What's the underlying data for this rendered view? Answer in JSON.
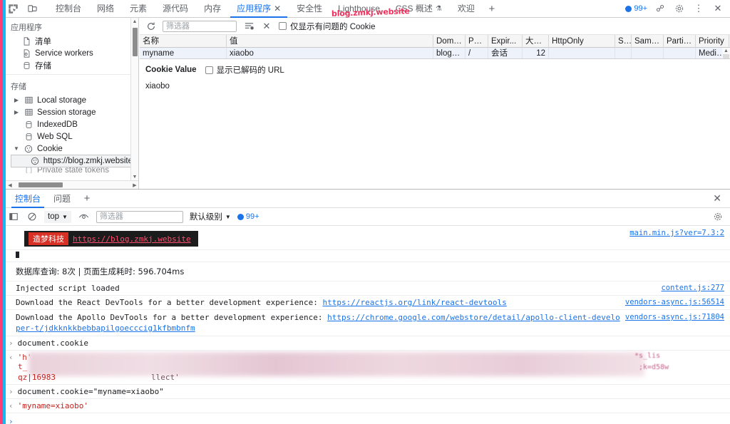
{
  "watermark": {
    "text": "blog.zmkj.website",
    "color": "#ef2f5c"
  },
  "topbar": {
    "icons": [
      {
        "name": "inspect-element-icon",
        "glyph": "inspect"
      },
      {
        "name": "device-toolbar-icon",
        "glyph": "device"
      }
    ],
    "tabs": [
      {
        "label": "控制台",
        "active": false,
        "closable": false
      },
      {
        "label": "网络",
        "active": false,
        "closable": false
      },
      {
        "label": "元素",
        "active": false,
        "closable": false
      },
      {
        "label": "源代码",
        "active": false,
        "closable": false
      },
      {
        "label": "内存",
        "active": false,
        "closable": false
      },
      {
        "label": "应用程序",
        "active": true,
        "closable": true
      },
      {
        "label": "安全性",
        "active": false,
        "closable": false
      },
      {
        "label": "Lighthouse",
        "active": false,
        "closable": false
      },
      {
        "label": "CSS 概述",
        "active": false,
        "closable": false
      },
      {
        "label": "欢迎",
        "active": false,
        "closable": false
      }
    ],
    "add_tab_label": "+",
    "error_badge": "99+",
    "right_icons": [
      {
        "name": "settings-devtools-icon"
      },
      {
        "name": "gear-icon"
      },
      {
        "name": "more-options-icon"
      },
      {
        "name": "close-devtools-icon"
      }
    ]
  },
  "sidebar": {
    "section_application": {
      "title": "应用程序",
      "items": [
        {
          "label": "清单",
          "icon": "manifest-icon"
        },
        {
          "label": "Service workers",
          "icon": "service-worker-icon"
        },
        {
          "label": "存储",
          "icon": "storage-icon"
        }
      ]
    },
    "section_storage": {
      "title": "存储",
      "items": [
        {
          "label": "Local storage",
          "icon": "table-icon",
          "twisty": "▶"
        },
        {
          "label": "Session storage",
          "icon": "table-icon",
          "twisty": "▶"
        },
        {
          "label": "IndexedDB",
          "icon": "database-icon",
          "twisty": ""
        },
        {
          "label": "Web SQL",
          "icon": "database-icon",
          "twisty": ""
        },
        {
          "label": "Cookie",
          "icon": "cookie-icon",
          "twisty": "▼"
        }
      ],
      "cookie_children": [
        {
          "label": "https://blog.zmkj.website",
          "icon": "cookie-icon",
          "selected": true
        }
      ]
    }
  },
  "cookie_toolbar": {
    "refresh_label": "refresh-icon",
    "filter_placeholder": "筛选器",
    "clear_filters_label": "clear-filter-icon",
    "clear_all_label": "clear-all-icon",
    "checkbox_label": "仅显示有问题的 Cookie",
    "checkbox_checked": false
  },
  "cookie_table": {
    "columns": [
      "名称",
      "值",
      "Domain",
      "Path",
      "Expir...",
      "大小",
      "HttpOnly",
      "S...",
      "SameS...",
      "Partiti...",
      "Priority"
    ],
    "sorted_column": "大小",
    "sort_arrow": "▲",
    "rows": [
      {
        "name": "myname",
        "value": "xiaobo",
        "domain": "blog.z...",
        "path": "/",
        "expires": "会话",
        "size": "12",
        "httponly": "",
        "secure": "",
        "samesite": "",
        "partition": "",
        "priority": "Medium"
      }
    ]
  },
  "cookie_preview": {
    "title": "Cookie Value",
    "decode_checkbox_label": "显示已解码的 URL",
    "decode_checked": false,
    "value": "xiaobo"
  },
  "drawer": {
    "tabs": [
      {
        "label": "控制台",
        "active": true
      },
      {
        "label": "问题",
        "active": false
      }
    ],
    "add_label": "+",
    "close_label": "✕"
  },
  "console_toolbar": {
    "sidebar_toggle": "console-sidebar-icon",
    "clear_label": "clear-console-icon",
    "context": "top",
    "context_caret": "▼",
    "eye_label": "live-expression-icon",
    "filter_placeholder": "筛选器",
    "level": "默认级别",
    "level_caret": "▼",
    "error_badge": "99+",
    "settings_label": "gear-icon"
  },
  "console_messages": [
    {
      "type": "banner",
      "badge": "造梦科技",
      "link": "https://blog.zmkj.website",
      "source": "main.min.js?ver=7.3:2"
    },
    {
      "type": "stats",
      "text": "数据库查询: 8次 | 页面生成耗时: 596.704ms",
      "source": ""
    },
    {
      "type": "log",
      "text": "Injected script loaded",
      "source": "content.js:277"
    },
    {
      "type": "log-link",
      "text": "Download the React DevTools for a better development experience: ",
      "link": "https://reactjs.org/link/react-devtools",
      "source": "vendors-async.js:56514"
    },
    {
      "type": "log-link",
      "text": "Download the Apollo DevTools for a better development experience: ",
      "link": "https://chrome.google.com/webstore/detail/apollo-client-developer-t/jdkknkkbebbapilgoecccig1kfbmbnfm",
      "source": "vendors-async.js:71804"
    },
    {
      "type": "input",
      "text": "document.cookie",
      "prompt": "›"
    },
    {
      "type": "output-blurred",
      "prompt": "‹",
      "visible_fragments": [
        "'h'",
        "t_",
        "qz|16983",
        "llect'",
        "*s_lis",
        ";k=d58w"
      ]
    },
    {
      "type": "input",
      "text": "document.cookie=\"myname=xiaobo\"",
      "prompt": "›"
    },
    {
      "type": "output",
      "prompt": "‹",
      "text": "'myname=xiaobo'"
    }
  ],
  "console_prompt": {
    "symbol": "›"
  }
}
